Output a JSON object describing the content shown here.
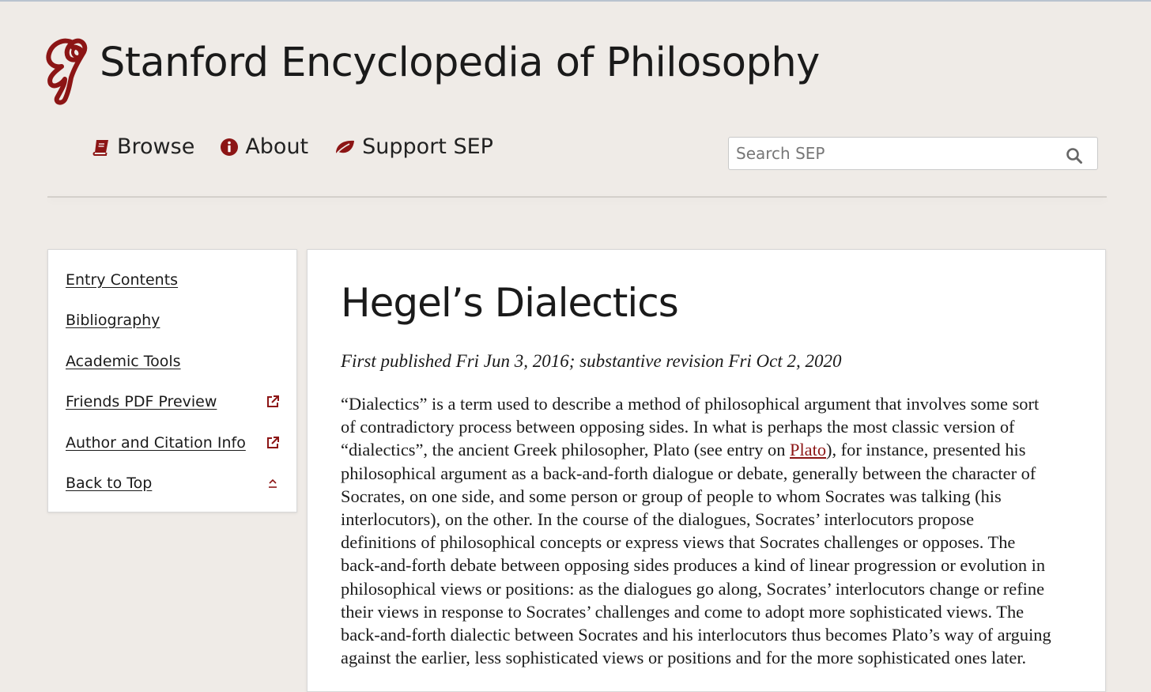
{
  "header": {
    "site_title": "Stanford Encyclopedia of Philosophy",
    "logo_icon": "sep-logo-icon",
    "nav": [
      {
        "label": "Browse",
        "icon": "book-icon"
      },
      {
        "label": "About",
        "icon": "info-circle-icon"
      },
      {
        "label": "Support SEP",
        "icon": "leaf-icon"
      }
    ],
    "search": {
      "placeholder": "Search SEP",
      "value": "",
      "icon": "search-icon"
    }
  },
  "sidebar": {
    "items": [
      {
        "label": "Entry Contents",
        "icon": ""
      },
      {
        "label": "Bibliography",
        "icon": ""
      },
      {
        "label": "Academic Tools",
        "icon": ""
      },
      {
        "label": "Friends PDF Preview",
        "icon": "external-link-icon"
      },
      {
        "label": "Author and Citation Info",
        "icon": "external-link-icon"
      },
      {
        "label": "Back to Top",
        "icon": "chevron-up-icon"
      }
    ]
  },
  "article": {
    "title": "Hegel’s Dialectics",
    "pub_info": "First published Fri Jun 3, 2016; substantive revision Fri Oct 2, 2020",
    "paragraph_lines": [
      "“Dialectics” is a term used to describe a method of philosophical argument that involves some sort",
      "of contradictory process between opposing sides. In what is perhaps the most classic version of",
      {
        "before": "“dialectics”, the ancient Greek philosopher, Plato (see entry on ",
        "link": "Plato",
        "after": "), for instance, presented his"
      },
      "philosophical argument as a back-and-forth dialogue or debate, generally between the character of",
      "Socrates, on one side, and some person or group of people to whom Socrates was talking (his",
      "interlocutors), on the other. In the course of the dialogues, Socrates’ interlocutors propose",
      "definitions of philosophical concepts or express views that Socrates challenges or opposes. The",
      "back-and-forth debate between opposing sides produces a kind of linear progression or evolution in",
      "philosophical views or positions: as the dialogues go along, Socrates’ interlocutors change or refine",
      "their views in response to Socrates’ challenges and come to adopt more sophisticated views. The",
      "back-and-forth dialectic between Socrates and his interlocutors thus becomes Plato’s way of arguing",
      "against the earlier, less sophisticated views or positions and for the more sophisticated ones later."
    ]
  },
  "colors": {
    "background": "#efebe7",
    "accent": "#8c1515",
    "panel": "#ffffff",
    "text": "#1a1a1a"
  }
}
